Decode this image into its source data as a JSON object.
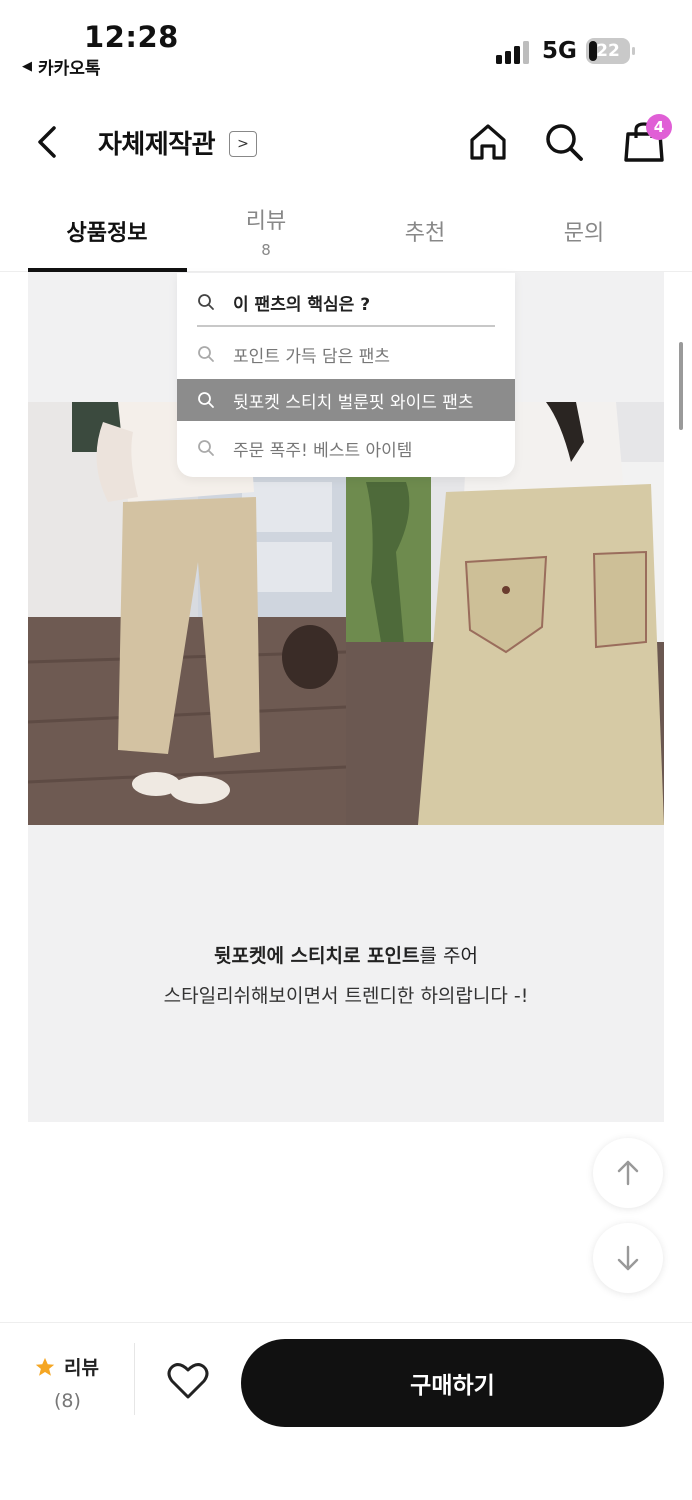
{
  "status_bar": {
    "time": "12:28",
    "back_app": "카카오톡",
    "network": "5G",
    "battery": "22",
    "battery_level": 0.22
  },
  "header": {
    "shop_name": "자체제작관",
    "cart_count": "4"
  },
  "tabs": [
    {
      "label": "상품정보",
      "count": "",
      "active": true
    },
    {
      "label": "리뷰",
      "count": "8",
      "active": false
    },
    {
      "label": "추천",
      "count": "",
      "active": false
    },
    {
      "label": "문의",
      "count": "",
      "active": false
    }
  ],
  "search_dropdown": {
    "query": "이 팬츠의 핵심은 ?",
    "suggestions": [
      {
        "text": "포인트 가득 담은 팬츠",
        "highlighted": false
      },
      {
        "text": "뒷포켓 스티치 벌룬핏 와이드 팬츠",
        "highlighted": true
      },
      {
        "text": "주문 폭주! 베스트 아이템",
        "highlighted": false
      }
    ]
  },
  "caption": {
    "line1_bold": "뒷포켓에 스티치로 포인트",
    "line1_rest": "를 주어",
    "line2": "스타일리쉬해보이면서 트렌디한 하의랍니다 -!"
  },
  "bottom_bar": {
    "review_label": "리뷰",
    "review_count": "(8)",
    "buy_label": "구매하기"
  },
  "colors": {
    "accent_badge": "#e05fd6",
    "buy_button": "#111111",
    "content_bg": "#f1f1f2",
    "star": "#f5a623"
  },
  "icons": [
    "back-arrow-icon",
    "chevron-right-icon",
    "home-icon",
    "search-icon",
    "shopping-bag-icon",
    "star-icon",
    "heart-icon",
    "arrow-up-icon",
    "arrow-down-icon"
  ]
}
